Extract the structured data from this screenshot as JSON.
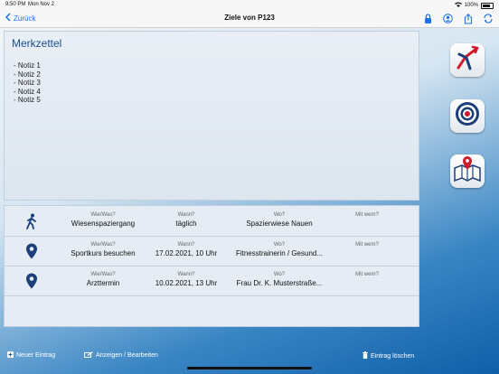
{
  "status": {
    "time": "9:50 PM",
    "date": "Mon Nov 2",
    "battery": "100%"
  },
  "nav": {
    "back_label": "Zurück",
    "title": "Ziele von P123"
  },
  "notes": {
    "title": "Merkzettel",
    "items": [
      "- Notiz 1",
      "- Notiz 2",
      "- Notiz 3",
      "- Notiz 4",
      "- Notiz 5"
    ]
  },
  "entries": {
    "labels": {
      "what": "Wie/Was?",
      "when": "Wann?",
      "where": "Wo?",
      "with": "Mit wem?"
    },
    "rows": [
      {
        "icon": "walking-person-icon",
        "what": "Wiesenspaziergang",
        "when": "täglich",
        "where": "Spazierwiese Nauen",
        "with": ""
      },
      {
        "icon": "location-pin-icon",
        "what": "Sportkurs besuchen",
        "when": "17.02.2021, 10 Uhr",
        "where": "Fitnesstrainerin / Gesund...",
        "with": ""
      },
      {
        "icon": "location-pin-icon",
        "what": "Arzttermin",
        "when": "10.02.2021, 13 Uhr",
        "where": "Frau Dr. K. Musterstraße...",
        "with": ""
      }
    ]
  },
  "bottom": {
    "new_entry": "Neuer Eintrag",
    "view_edit": "Anzeigen / Bearbeiten",
    "delete_entry": "Eintrag löschen"
  },
  "sidebar": {
    "buttons": [
      "direction-arrows-icon",
      "target-icon",
      "map-pin-icon"
    ]
  },
  "colors": {
    "accent": "#1a73e8",
    "title_blue": "#1b4f93",
    "background_blue": "#0f5fa8",
    "pin_blue": "#1c3f7a"
  }
}
